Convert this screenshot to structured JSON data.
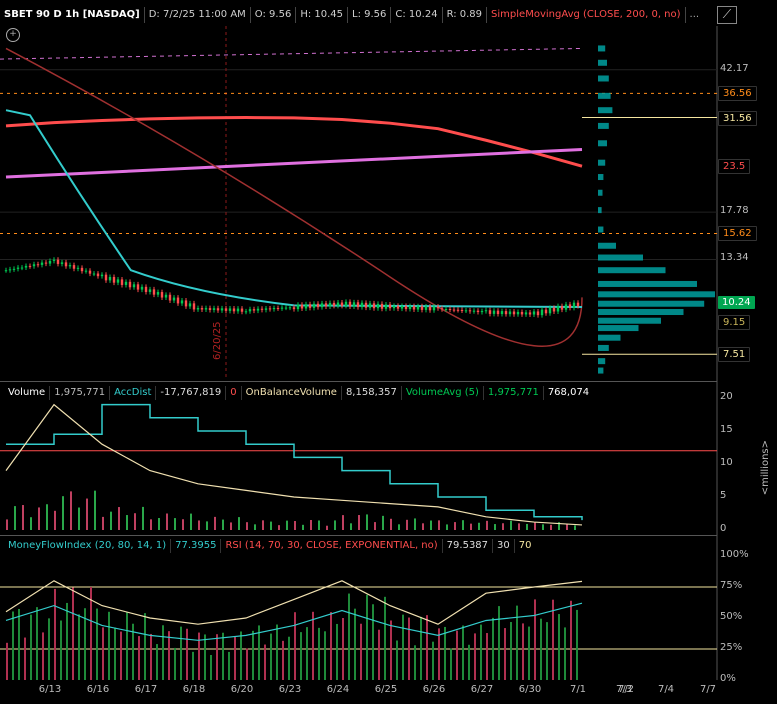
{
  "header": {
    "symbol": "SBET 90 D 1h [NASDAQ]",
    "date": "D: 7/2/25 11:00 AM",
    "open": "O: 9.56",
    "high": "H: 10.45",
    "low": "L: 9.56",
    "close": "C: 10.24",
    "range": "R: 0.89",
    "study": "SimpleMovingAvg (CLOSE, 200, 0, no)",
    "more": "..."
  },
  "price_panel": {
    "axis_labels": [
      "42.17",
      "17.78",
      "13.34"
    ],
    "price_tags": [
      {
        "value": "36.56",
        "bg": "#000000",
        "fg": "#ff8c1a"
      },
      {
        "value": "31.56",
        "bg": "#000000",
        "fg": "#f5e6a0"
      },
      {
        "value": "23.5",
        "bg": "#000000",
        "fg": "#ff4d4d"
      },
      {
        "value": "15.62",
        "bg": "#000000",
        "fg": "#ff8c1a"
      },
      {
        "value": "10.24",
        "bg": "#00a651",
        "fg": "#ffffff"
      },
      {
        "value": "9.15",
        "bg": "#000000",
        "fg": "#c8b45a"
      },
      {
        "value": "7.51",
        "bg": "#000000",
        "fg": "#f5e6a0"
      }
    ],
    "vertical_marker": "6/20/25"
  },
  "volume_panel": {
    "title": "Volume",
    "volume": "1,975,771",
    "accdist_label": "AccDist",
    "accdist_value": "-17,767,819",
    "accdist_zero": "0",
    "obv_label": "OnBalanceVolume",
    "obv_value": "8,158,357",
    "volavg_label": "VolumeAvg (5)",
    "volavg_value": "1,975,771",
    "volavg_value2": "768,074",
    "axis_labels": [
      "20",
      "15",
      "10",
      "5",
      "0"
    ],
    "unit": "<millions>"
  },
  "oscillator_panel": {
    "mfi_label": "MoneyFlowIndex (20, 80, 14, 1)",
    "mfi_value": "77.3955",
    "rsi_label": "RSI (14, 70, 30, CLOSE, EXPONENTIAL, no)",
    "rsi_value": "79.5387",
    "rsi_low": "30",
    "rsi_high": "70",
    "axis_labels": [
      "100%",
      "75%",
      "50%",
      "25%",
      "0%"
    ]
  },
  "x_axis": {
    "labels": [
      "6/13",
      "6/16",
      "6/17",
      "6/18",
      "6/20",
      "6/23",
      "6/24",
      "6/25",
      "6/26",
      "6/27",
      "6/30",
      "7/1",
      "7/2",
      "7/3",
      "7/4",
      "7/7"
    ]
  },
  "colors": {
    "price_up": "#00c853",
    "price_down": "#ff4d4d",
    "sma200": "#ff4d4d",
    "sma_pink": "#e070e0",
    "ema_cyan": "#33cccc",
    "volume_profile": "#00a0a0",
    "mfi": "#33cccc",
    "rsi": "#f0e0b0"
  },
  "chart_data": [
    {
      "type": "line",
      "title": "SBET 90 D 1h [NASDAQ]",
      "x_categories": [
        "6/13",
        "6/16",
        "6/17",
        "6/18",
        "6/20",
        "6/23",
        "6/24",
        "6/25",
        "6/26",
        "6/27",
        "6/30",
        "7/1",
        "7/2"
      ],
      "series": [
        {
          "name": "Close",
          "values": [
            12.5,
            13.2,
            12.0,
            11.0,
            9.9,
            9.8,
            10.0,
            10.2,
            10.0,
            9.9,
            9.7,
            9.6,
            10.24
          ]
        },
        {
          "name": "SimpleMovingAvg (CLOSE, 200, 0, no)",
          "values": [
            30.0,
            30.6,
            31.0,
            31.3,
            31.5,
            31.56,
            31.5,
            31.2,
            30.5,
            29.5,
            27.5,
            25.5,
            23.5
          ]
        }
      ],
      "ylim": [
        6.5,
        55
      ]
    },
    {
      "type": "bar",
      "title": "Volume",
      "x_categories": [
        "6/13",
        "6/16",
        "6/17",
        "6/18",
        "6/20",
        "6/23",
        "6/24",
        "6/25",
        "6/26",
        "6/27",
        "6/30",
        "7/1",
        "7/2"
      ],
      "series": [
        {
          "name": "Volume",
          "values": [
            4.0,
            6.0,
            3.5,
            2.5,
            2.0,
            1.5,
            1.6,
            2.5,
            1.8,
            1.5,
            1.4,
            1.2,
            1.97
          ]
        },
        {
          "name": "VolumeAvg (5)",
          "values": [
            9.0,
            19.0,
            13.0,
            9.0,
            7.0,
            6.0,
            5.0,
            4.5,
            4.0,
            3.5,
            2.0,
            1.2,
            0.77
          ]
        }
      ],
      "ylim": [
        0,
        20
      ],
      "ylabel": "<millions>"
    },
    {
      "type": "line",
      "title": "MoneyFlowIndex (20, 80, 14, 1)",
      "x_categories": [
        "6/13",
        "6/16",
        "6/17",
        "6/18",
        "6/20",
        "6/23",
        "6/24",
        "6/25",
        "6/26",
        "6/27",
        "6/30",
        "7/1",
        "7/2"
      ],
      "series": [
        {
          "name": "MoneyFlowIndex (20, 80, 14, 1)",
          "values": [
            60,
            75,
            55,
            45,
            40,
            45,
            55,
            70,
            55,
            45,
            60,
            65,
            77.3955
          ]
        },
        {
          "name": "RSI (14, 70, 30, CLOSE, EXPONENTIAL, no)",
          "values": [
            55,
            80,
            60,
            50,
            45,
            50,
            65,
            80,
            60,
            45,
            70,
            75,
            79.5387
          ]
        }
      ],
      "ylim": [
        0,
        100
      ]
    }
  ]
}
